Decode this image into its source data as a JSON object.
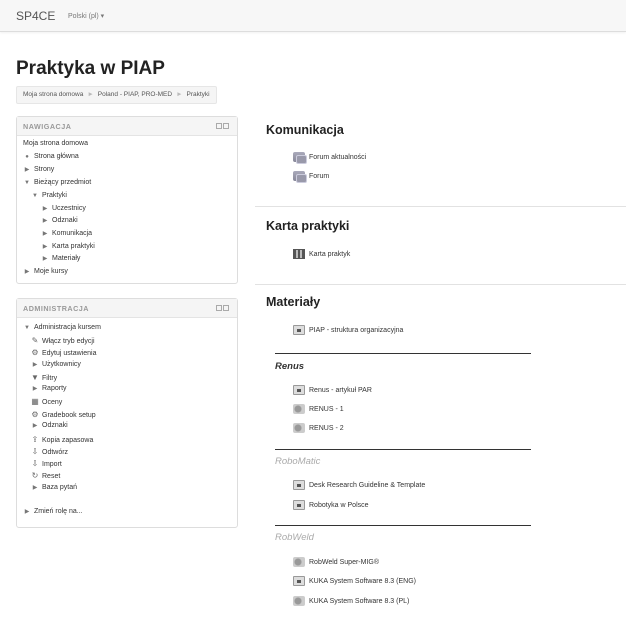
{
  "topbar": {
    "brand": "SP4CE",
    "language": "Polski (pl) ▾"
  },
  "page_title": "Praktyka w PIAP",
  "breadcrumb": [
    "Moja strona domowa",
    "Poland - PIAP, PRO-MED",
    "Praktyki"
  ],
  "navigation": {
    "title": "NAWIGACJA",
    "items": [
      {
        "label": "Moja strona domowa",
        "icon": "none"
      },
      {
        "label": "Strona główna",
        "icon": "bullet-icon"
      },
      {
        "label": "Strony",
        "icon": "chevron-right-icon"
      },
      {
        "label": "Bieżący przedmiot",
        "icon": "chevron-down-icon"
      },
      {
        "label": "Praktyki",
        "icon": "chevron-down-icon"
      },
      {
        "label": "Uczestnicy",
        "icon": "chevron-right-icon"
      },
      {
        "label": "Odznaki",
        "icon": "chevron-right-icon"
      },
      {
        "label": "Komunikacja",
        "icon": "chevron-right-icon"
      },
      {
        "label": "Karta praktyki",
        "icon": "chevron-right-icon"
      },
      {
        "label": "Materiały",
        "icon": "chevron-right-icon"
      },
      {
        "label": "Moje kursy",
        "icon": "chevron-right-icon"
      }
    ]
  },
  "administration": {
    "title": "ADMINISTRACJA",
    "items": [
      {
        "label": "Administracja kursem",
        "icon": "chevron-down-icon"
      },
      {
        "label": "Włącz tryb edycji",
        "icon": "pencil-icon"
      },
      {
        "label": "Edytuj ustawienia",
        "icon": "gear-icon"
      },
      {
        "label": "Użytkownicy",
        "icon": "chevron-right-icon"
      },
      {
        "label": "Filtry",
        "icon": "filter-icon"
      },
      {
        "label": "Raporty",
        "icon": "chevron-right-icon"
      },
      {
        "label": "Oceny",
        "icon": "grades-icon"
      },
      {
        "label": "Gradebook setup",
        "icon": "gear-icon"
      },
      {
        "label": "Odznaki",
        "icon": "chevron-right-icon"
      },
      {
        "label": "Kopia zapasowa",
        "icon": "backup-icon"
      },
      {
        "label": "Odtwórz",
        "icon": "restore-icon"
      },
      {
        "label": "Import",
        "icon": "import-icon"
      },
      {
        "label": "Reset",
        "icon": "reset-icon"
      },
      {
        "label": "Baza pytań",
        "icon": "chevron-right-icon"
      },
      {
        "label": "Zmień rolę na...",
        "icon": "chevron-right-icon"
      }
    ]
  },
  "sections": {
    "komunikacja": {
      "title": "Komunikacja",
      "items": [
        "Forum aktualności",
        "Forum"
      ]
    },
    "karta": {
      "title": "Karta praktyki",
      "items": [
        "Karta praktyk"
      ]
    },
    "materialy": {
      "title": "Materiały",
      "top_item": "PIAP - struktura organizacyjna",
      "renus": {
        "heading": "Renus",
        "items": [
          "Renus - artykuł PAR",
          "RENUS - 1",
          "RENUS - 2"
        ]
      },
      "robomatic": {
        "heading": "RoboMatic",
        "items": [
          "Desk Research Guideline & Template",
          "Robotyka w Polsce"
        ]
      },
      "robweld": {
        "heading": "RobWeld",
        "items": [
          "RobWeld Super-MIG®",
          "KUKA System Software 8.3 (ENG)",
          "KUKA System Software 8.3 (PL)"
        ]
      }
    }
  }
}
